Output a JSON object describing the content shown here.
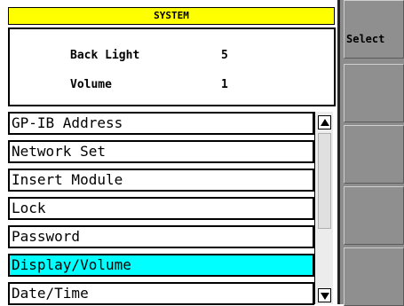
{
  "header": {
    "title": "SYSTEM"
  },
  "info": {
    "rows": [
      {
        "label": "Back Light",
        "value": "5"
      },
      {
        "label": "Volume",
        "value": "1"
      }
    ]
  },
  "menu": {
    "items": [
      {
        "label": "GP-IB Address"
      },
      {
        "label": "Network Set"
      },
      {
        "label": "Insert Module"
      },
      {
        "label": "Lock"
      },
      {
        "label": "Password"
      },
      {
        "label": "Display/Volume",
        "selected": true
      },
      {
        "label": "Date/Time"
      }
    ]
  },
  "softkeys": {
    "select_label": "Select"
  },
  "colors": {
    "header_bg": "#ffff00",
    "selected_bg": "#00ffff",
    "softkey_panel": "#8c8c8c"
  },
  "icons": {
    "scroll_up": "triangle-up-icon",
    "scroll_down": "triangle-down-icon"
  }
}
